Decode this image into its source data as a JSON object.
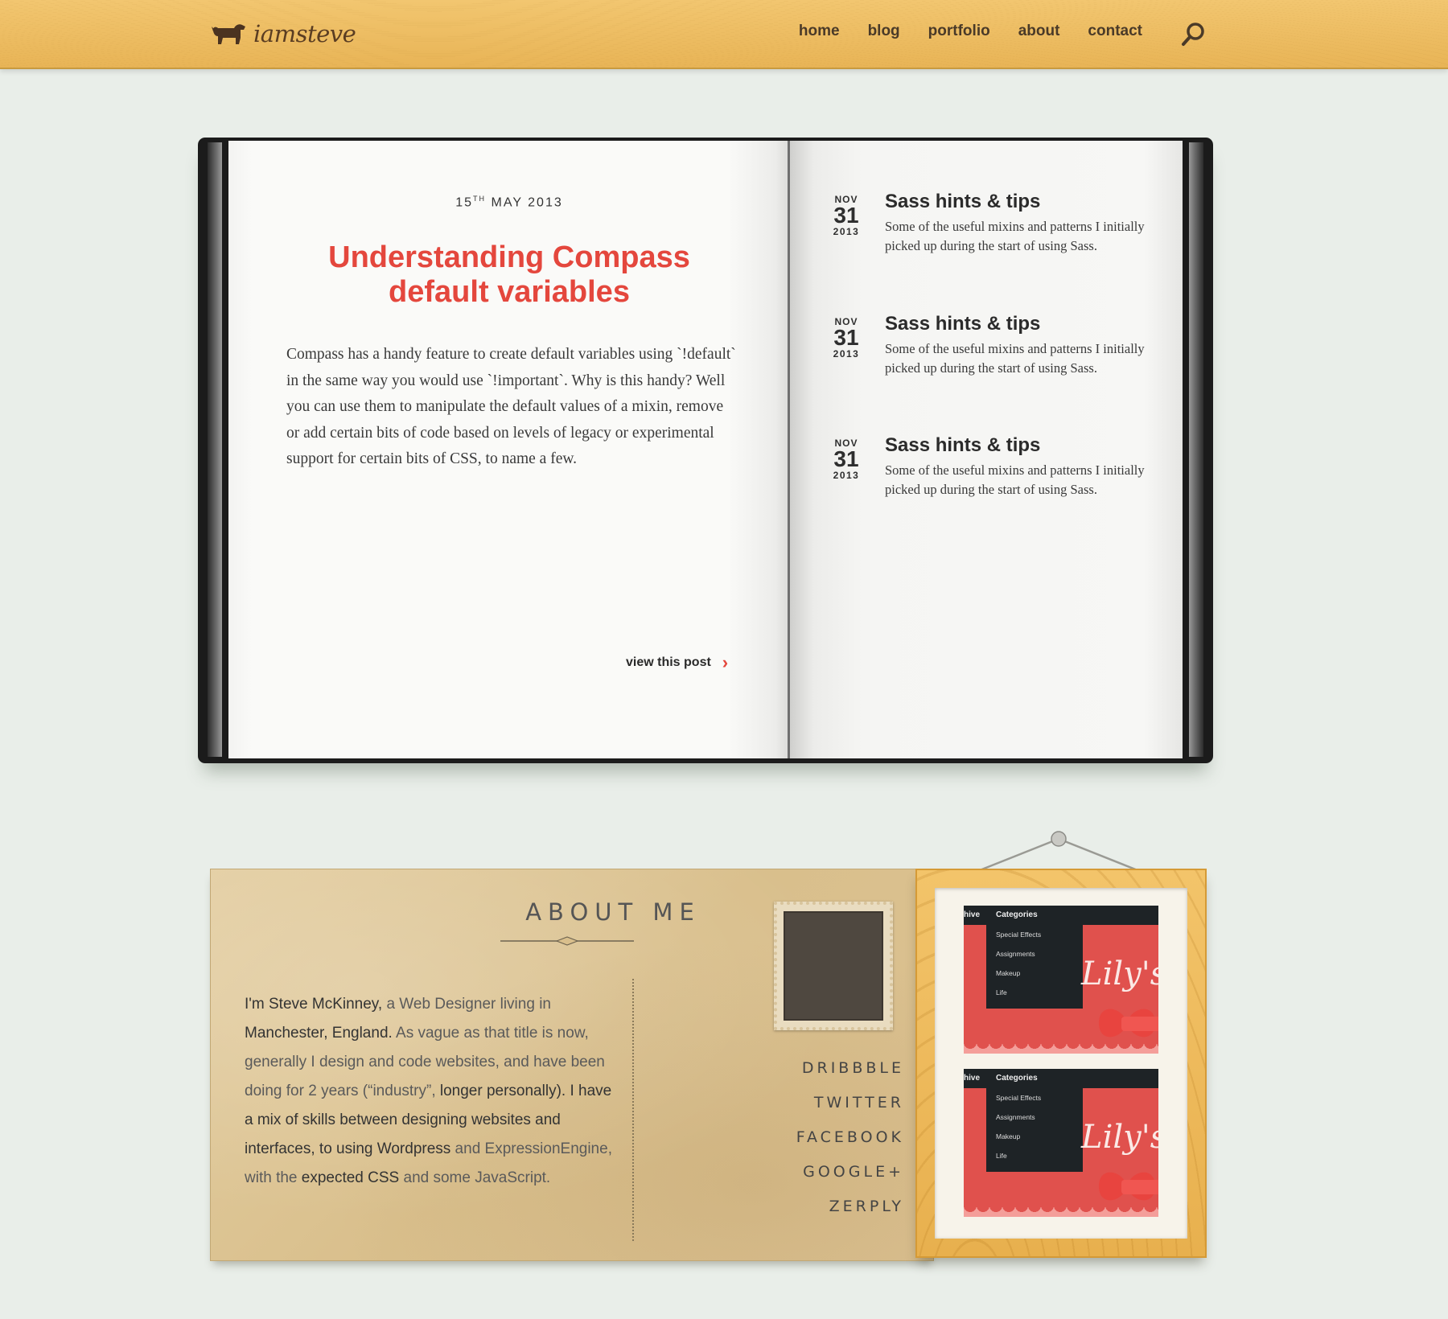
{
  "header": {
    "logo_text": "iamsteve",
    "nav": [
      "home",
      "blog",
      "portfolio",
      "about",
      "contact"
    ],
    "search_icon": "search-icon"
  },
  "featured_post": {
    "date_day": "15",
    "date_suffix": "TH",
    "date_rest": "MAY 2013",
    "title": "Understanding Compass default variables",
    "excerpt": "Compass has a handy feature to create default variables using `!default` in the same way you would use `!important`. Why is this handy? Well you can use them to manipulate the default values of a mixin, remove or add certain bits of code based on levels of legacy or experimental support for certain bits of CSS, to name a few.",
    "link_label": "view this post",
    "link_icon": "chevron-right-icon"
  },
  "recent_posts": [
    {
      "month": "NOV",
      "day": "31",
      "year": "2013",
      "title": "Sass hints & tips",
      "text": "Some of the useful mixins and patterns I initially picked up during the start of using Sass."
    },
    {
      "month": "NOV",
      "day": "31",
      "year": "2013",
      "title": "Sass hints & tips",
      "text": "Some of the useful mixins and patterns I initially picked up during the start of using Sass."
    },
    {
      "month": "NOV",
      "day": "31",
      "year": "2013",
      "title": "Sass hints & tips",
      "text": "Some of the useful mixins and patterns I initially picked up during the start of using Sass."
    }
  ],
  "about": {
    "title": "ABOUT ME",
    "text_parts": [
      "I'm Steve McKinney,",
      " a Web Designer living in ",
      "Manchester, England.",
      " As vague as that title is now, generally I design and code websites, and have been doing for 2 years (“industry”,",
      " longer personally). I have a mix of skills between designing websites and interfaces, to using ",
      "Wordpress",
      " and ExpressionEngine, with the ",
      "expected CSS",
      " and some JavaScript."
    ],
    "social": [
      "DRIBBBLE",
      "TWITTER",
      "FACEBOOK",
      "GOOGLE+",
      "ZERPLY"
    ]
  },
  "portfolio_shots": [
    {
      "menu_left": "hive",
      "menu_title": "Categories",
      "items": [
        "Special Effects",
        "Assignments",
        "Makeup",
        "Life"
      ],
      "script": "Lily's"
    },
    {
      "menu_left": "hive",
      "menu_title": "Categories",
      "items": [
        "Special Effects",
        "Assignments",
        "Makeup",
        "Life"
      ],
      "script": "Lily's"
    }
  ],
  "colors": {
    "accent": "#e4473d",
    "header": "#edb95e",
    "background": "#e9eee9"
  }
}
